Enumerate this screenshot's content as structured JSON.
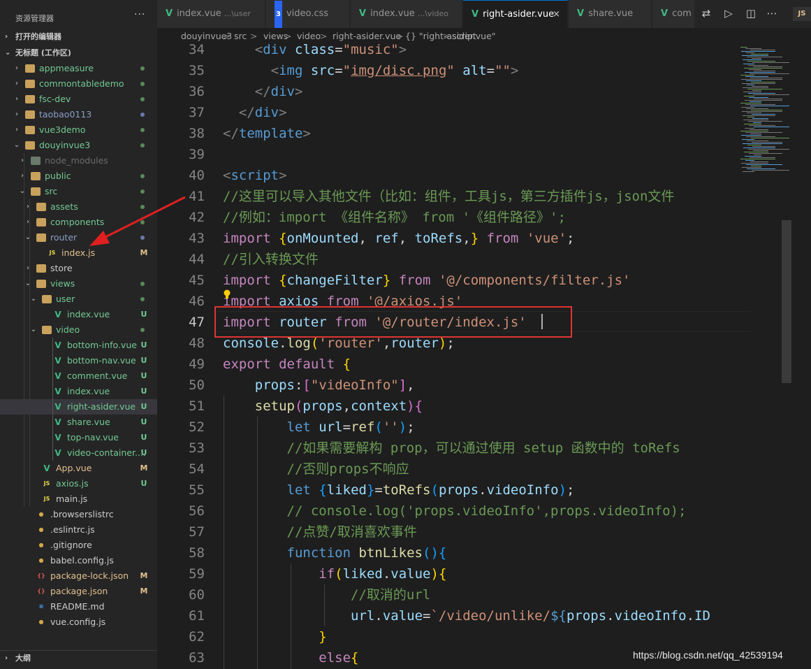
{
  "explorer": {
    "title": "资源管理器",
    "more": "···",
    "open_editors": "打开的编辑器",
    "workspace": "无标题 (工作区)",
    "outline": "大纲",
    "tree": [
      {
        "name": "appmeasure",
        "type": "folder",
        "status": "dot",
        "color": "green"
      },
      {
        "name": "commontabledemo",
        "type": "folder",
        "status": "dot",
        "color": "green"
      },
      {
        "name": "fsc-dev",
        "type": "folder",
        "status": "dot",
        "color": "green"
      },
      {
        "name": "taobao0113",
        "type": "folder",
        "status": "dot",
        "color": "blue"
      },
      {
        "name": "vue3demo",
        "type": "folder",
        "status": "dot",
        "color": "green"
      },
      {
        "name": "douyinvue3",
        "type": "folder",
        "status": "dot",
        "color": "green"
      },
      {
        "name": "node_modules",
        "type": "folder",
        "status": "",
        "color": "dim"
      },
      {
        "name": "public",
        "type": "folder",
        "status": "dot",
        "color": "green"
      },
      {
        "name": "src",
        "type": "folder",
        "status": "dot",
        "color": "green"
      },
      {
        "name": "assets",
        "type": "folder",
        "status": "dot",
        "color": "green"
      },
      {
        "name": "components",
        "type": "folder",
        "status": "dot",
        "color": "green"
      },
      {
        "name": "router",
        "type": "folder",
        "status": "dot",
        "color": "blue"
      },
      {
        "name": "index.js",
        "type": "js",
        "status": "M",
        "color": "yellow"
      },
      {
        "name": "store",
        "type": "folder",
        "status": "",
        "color": "white"
      },
      {
        "name": "views",
        "type": "folder",
        "status": "dot",
        "color": "green"
      },
      {
        "name": "user",
        "type": "folder",
        "status": "dot",
        "color": "green"
      },
      {
        "name": "index.vue",
        "type": "vue",
        "status": "U",
        "color": "green"
      },
      {
        "name": "video",
        "type": "folder",
        "status": "dot",
        "color": "green"
      },
      {
        "name": "bottom-info.vue",
        "type": "vue",
        "status": "U",
        "color": "green"
      },
      {
        "name": "bottom-nav.vue",
        "type": "vue",
        "status": "U",
        "color": "green"
      },
      {
        "name": "comment.vue",
        "type": "vue",
        "status": "U",
        "color": "green"
      },
      {
        "name": "index.vue",
        "type": "vue",
        "status": "U",
        "color": "green"
      },
      {
        "name": "right-asider.vue",
        "type": "vue",
        "status": "U",
        "color": "green"
      },
      {
        "name": "share.vue",
        "type": "vue",
        "status": "U",
        "color": "green"
      },
      {
        "name": "top-nav.vue",
        "type": "vue",
        "status": "U",
        "color": "green"
      },
      {
        "name": "video-container....",
        "type": "vue",
        "status": "U",
        "color": "green"
      },
      {
        "name": "App.vue",
        "type": "vue",
        "status": "M",
        "color": "yellow"
      },
      {
        "name": "axios.js",
        "type": "js",
        "status": "U",
        "color": "green"
      },
      {
        "name": "main.js",
        "type": "js",
        "status": "",
        "color": "white"
      },
      {
        "name": ".browserslistrc",
        "type": "cfg",
        "status": "",
        "color": "white"
      },
      {
        "name": ".eslintrc.js",
        "type": "cfg",
        "status": "",
        "color": "white"
      },
      {
        "name": ".gitignore",
        "type": "cfg",
        "status": "",
        "color": "white"
      },
      {
        "name": "babel.config.js",
        "type": "cfg",
        "status": "",
        "color": "white"
      },
      {
        "name": "package-lock.json",
        "type": "json",
        "status": "M",
        "color": "yellow"
      },
      {
        "name": "package.json",
        "type": "json",
        "status": "M",
        "color": "yellow"
      },
      {
        "name": "README.md",
        "type": "md",
        "status": "",
        "color": "white"
      },
      {
        "name": "vue.config.js",
        "type": "cfg",
        "status": "",
        "color": "white"
      }
    ]
  },
  "tabs": [
    {
      "label": "index.vue",
      "hint": "...\\user",
      "icon": "V"
    },
    {
      "label": "video.css",
      "hint": "",
      "icon": "3"
    },
    {
      "label": "index.vue",
      "hint": "...\\video",
      "icon": "V"
    },
    {
      "label": "right-asider.vue",
      "hint": "",
      "icon": "V",
      "close": "×"
    },
    {
      "label": "share.vue",
      "hint": "",
      "icon": "V"
    },
    {
      "label": "com",
      "hint": "",
      "icon": "V"
    }
  ],
  "breadcrumb": [
    "douyinvue3",
    ">",
    "src",
    ">",
    "views",
    ">",
    "video",
    ">",
    "right-asider.vue",
    ">",
    "{} \"right-asider.vue\"",
    ">",
    "script"
  ],
  "line_numbers": [
    "34",
    "35",
    "36",
    "37",
    "38",
    "39",
    "40",
    "41",
    "42",
    "43",
    "44",
    "45",
    "46",
    "47",
    "48",
    "49",
    "50",
    "51",
    "52",
    "53",
    "54",
    "55",
    "56",
    "57",
    "58",
    "59",
    "60",
    "61",
    "62",
    "63"
  ],
  "watermark": "https://blog.csdn.net/qq_42539194",
  "badge": "JS"
}
